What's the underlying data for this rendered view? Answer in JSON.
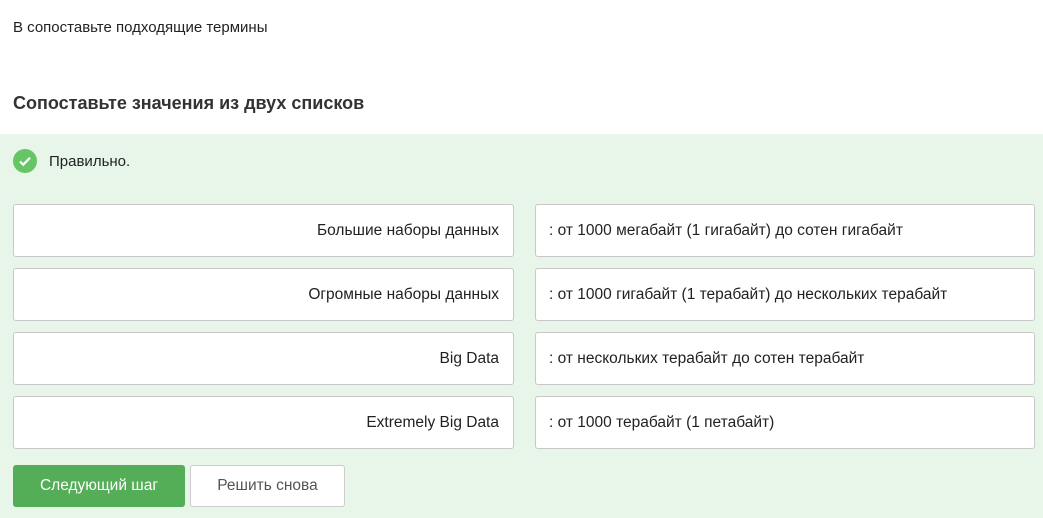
{
  "instruction": "В сопоставьте подходящие термины",
  "question_title": "Сопоставьте значения из двух списков",
  "status": {
    "text": "Правильно.",
    "icon": "check-circle-icon",
    "color": "#66c666"
  },
  "pairs": [
    {
      "term": "Большие наборы данных",
      "value": ": от 1000 мегабайт (1 гигабайт) до сотен гигабайт"
    },
    {
      "term": "Огромные наборы данных",
      "value": ": от 1000 гигабайт (1 терабайт) до нескольких терабайт"
    },
    {
      "term": "Big Data",
      "value": ": от нескольких терабайт до сотен терабайт"
    },
    {
      "term": "Extremely Big Data",
      "value": ": от 1000 терабайт (1 петабайт)"
    }
  ],
  "buttons": {
    "next": "Следующий шаг",
    "retry": "Решить снова"
  }
}
